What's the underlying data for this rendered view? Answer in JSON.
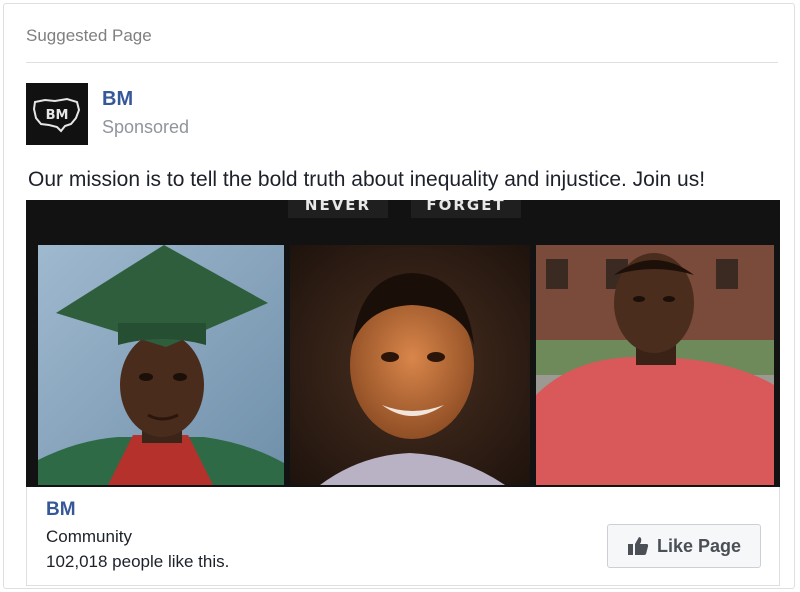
{
  "header": {
    "label": "Suggested Page"
  },
  "post": {
    "page_name": "BM",
    "sponsored": "Sponsored",
    "message": "Our mission is to tell the bold truth about inequality and injustice. Join us!",
    "avatar_text": "BM"
  },
  "image": {
    "banner_left": "NEVER",
    "banner_right": "FORGET",
    "photos": [
      "graduation-portrait",
      "boy-portrait",
      "man-in-red-shirt"
    ]
  },
  "footer": {
    "name": "BM",
    "category": "Community",
    "likes": "102,018 people like this.",
    "like_button": "Like Page"
  },
  "colors": {
    "link": "#365899",
    "muted": "#90949c",
    "border": "#dddfe2"
  }
}
